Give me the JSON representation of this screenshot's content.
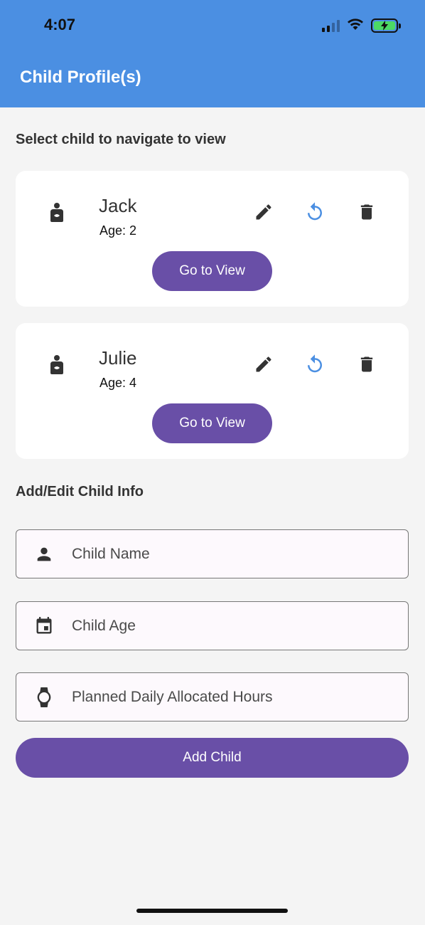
{
  "status_bar": {
    "time": "4:07"
  },
  "app_bar": {
    "title": "Child Profile(s)"
  },
  "children_section": {
    "title": "Select child to navigate to view",
    "children": [
      {
        "name": "Jack",
        "age_label": "Age: 2",
        "button_label": "Go to View"
      },
      {
        "name": "Julie",
        "age_label": "Age: 4",
        "button_label": "Go to View"
      }
    ]
  },
  "form": {
    "title": "Add/Edit Child Info",
    "name_field": {
      "placeholder": "Child Name",
      "value": "",
      "icon": "person-icon"
    },
    "age_field": {
      "placeholder": "Child Age",
      "value": "",
      "icon": "calendar-icon"
    },
    "hours_field": {
      "placeholder": "Planned Daily Allocated Hours",
      "value": "",
      "icon": "watch-icon"
    },
    "submit_label": "Add Child"
  },
  "colors": {
    "header": "#4b8fe2",
    "primary": "#694fa7",
    "reset_icon": "#4b8fe2",
    "background": "#f4f4f4"
  }
}
